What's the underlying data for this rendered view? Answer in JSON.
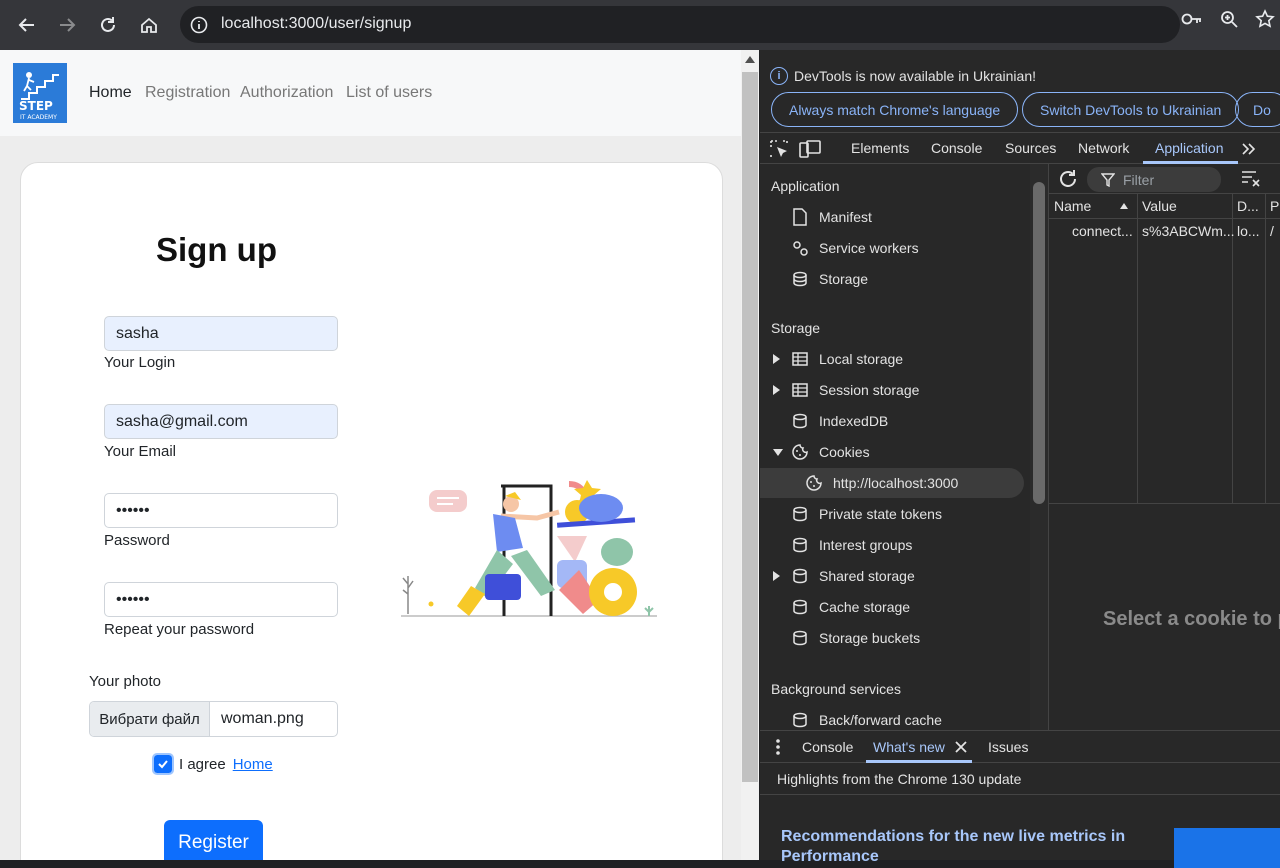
{
  "browser": {
    "url": "localhost:3000/user/signup"
  },
  "site": {
    "logo": {
      "line1": "STEP",
      "line2": "IT ACADEMY"
    },
    "nav": [
      {
        "label": "Home",
        "active": true
      },
      {
        "label": "Registration",
        "active": false
      },
      {
        "label": "Authorization",
        "active": false
      },
      {
        "label": "List of users",
        "active": false
      }
    ]
  },
  "signup": {
    "title": "Sign up",
    "login": {
      "value": "sasha",
      "label": "Your Login"
    },
    "email": {
      "value": "sasha@gmail.com",
      "label": "Your Email"
    },
    "password": {
      "value": "••••••",
      "label": "Password"
    },
    "repeat_password": {
      "value": "••••••",
      "label": "Repeat your password"
    },
    "photo": {
      "label": "Your photo",
      "button": "Вибрати файл",
      "filename": "woman.png"
    },
    "agree": {
      "text": "I agree",
      "link": "Home",
      "checked": true
    },
    "submit": "Register"
  },
  "devtools": {
    "info": "DevTools is now available in Ukrainian!",
    "pills": [
      "Always match Chrome's language",
      "Switch DevTools to Ukrainian",
      "Do"
    ],
    "tabs": [
      "Elements",
      "Console",
      "Sources",
      "Network",
      "Application"
    ],
    "active_tab": "Application",
    "sidebar": {
      "application_head": "Application",
      "application_items": [
        "Manifest",
        "Service workers",
        "Storage"
      ],
      "storage_head": "Storage",
      "storage_items": [
        "Local storage",
        "Session storage",
        "IndexedDB",
        "Cookies",
        "http://localhost:3000",
        "Private state tokens",
        "Interest groups",
        "Shared storage",
        "Cache storage",
        "Storage buckets"
      ],
      "background_head": "Background services",
      "background_items": [
        "Back/forward cache"
      ]
    },
    "filter_placeholder": "Filter",
    "cookie_table": {
      "headers": [
        "Name",
        "Value",
        "D...",
        "P"
      ],
      "rows": [
        [
          "connect...",
          "s%3ABCWm...",
          "lo...",
          "/"
        ]
      ]
    },
    "empty_message": "Select a cookie to p",
    "drawer": {
      "tabs": [
        "Console",
        "What's new",
        "Issues"
      ],
      "active_tab": "What's new",
      "subtitle": "Highlights from the Chrome 130 update",
      "recommendation": "Recommendations for the new live metrics in Performance"
    }
  },
  "colors": {
    "primary": "#0d6efd",
    "devtools_accent": "#a8c7fa",
    "devtools_bg": "#282828",
    "chrome_bar": "#35363a"
  }
}
